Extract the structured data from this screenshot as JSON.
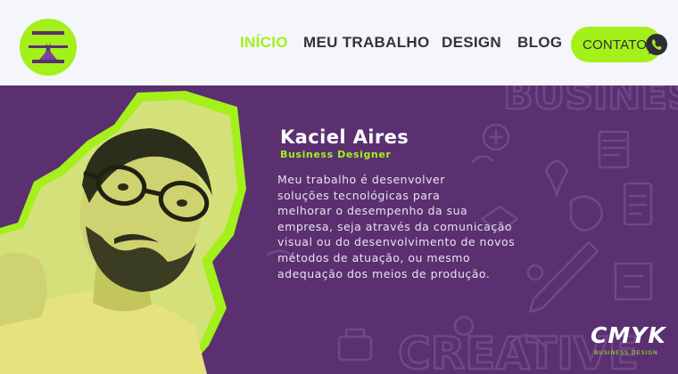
{
  "header": {
    "nav": [
      {
        "label": "INÍCIO",
        "active": true
      },
      {
        "label": "MEU TRABALHO",
        "active": false
      },
      {
        "label": "DESIGN",
        "active": false
      },
      {
        "label": "BLOG",
        "active": false
      }
    ],
    "cta_label": "CONTATO",
    "cta_icon": "whatsapp-icon",
    "logo_icon": "hourglass-logo-icon"
  },
  "hero": {
    "name": "Kaciel Aires",
    "role": "Business Designer",
    "bio_lines": [
      "Meu trabalho é desenvolver",
      "soluções tecnológicas para",
      "melhorar o desempenho da sua",
      "empresa, seja através da comunicação",
      "visual ou do desenvolvimento de novos",
      "métodos de atuação, ou mesmo",
      "adequação dos meios de produção."
    ],
    "background_words": [
      "BUSINESS",
      "CREATIVE"
    ],
    "brand_mark": "CMYK",
    "brand_sub": "BUSINESS DESIGN"
  },
  "colors": {
    "accent": "#a4f01a",
    "hero_bg": "#5a3070",
    "header_bg": "#f4f6fa",
    "nav_text": "#33333d"
  }
}
